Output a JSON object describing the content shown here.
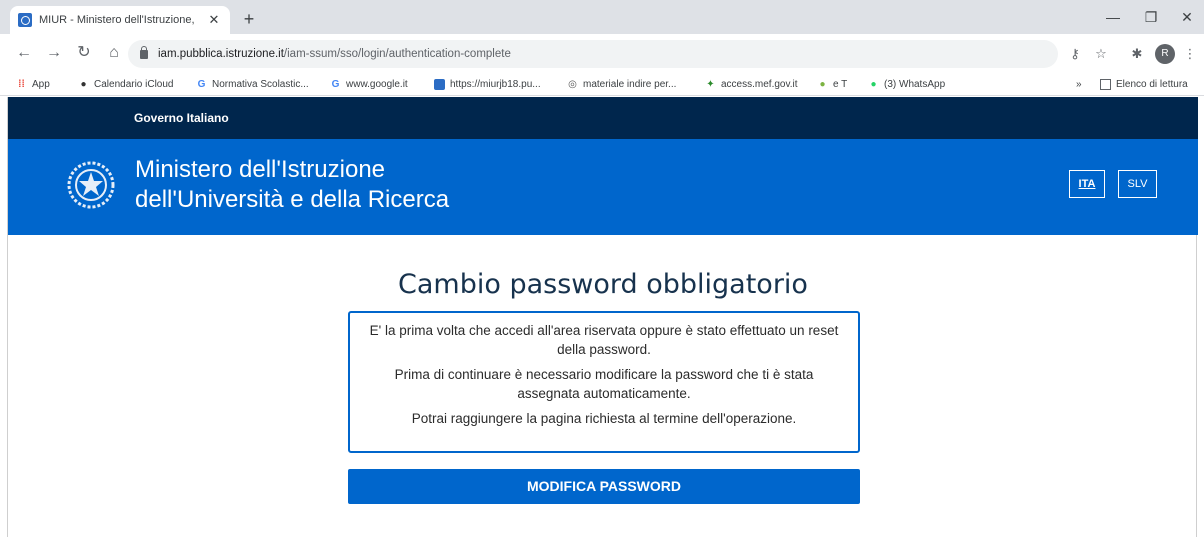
{
  "browser": {
    "tab_title": "MIUR - Ministero dell'Istruzione,",
    "tab_close": "✕",
    "new_tab": "+",
    "url_host": "iam.pubblica.istruzione.it",
    "url_path": "/iam-ssum/sso/login/authentication-complete",
    "profile_initial": "R",
    "bookmarks": [
      {
        "label": "App",
        "icon": "apps-grid-icon"
      },
      {
        "label": "Calendario iCloud",
        "icon": "apple-icon"
      },
      {
        "label": "Normativa Scolastic...",
        "icon": "google-icon"
      },
      {
        "label": "www.google.it",
        "icon": "google-icon"
      },
      {
        "label": "https://miurjb18.pu...",
        "icon": "miur-icon"
      },
      {
        "label": "materiale indire per...",
        "icon": "globe-icon"
      },
      {
        "label": "access.mef.gov.it",
        "icon": "mef-icon"
      },
      {
        "label": "e T",
        "icon": "globe-green-icon"
      },
      {
        "label": "(3) WhatsApp",
        "icon": "whatsapp-icon"
      }
    ],
    "bookmarks_overflow": "»",
    "reading_list": "Elenco di lettura"
  },
  "page": {
    "gov_label": "Governo Italiano",
    "ministry_line1": "Ministero dell'Istruzione",
    "ministry_line2": "dell'Università e della Ricerca",
    "lang_ita": "ITA",
    "lang_slv": "SLV",
    "heading": "Cambio password obbligatorio",
    "info_p1": "E' la prima volta che accedi all'area riservata oppure è stato effettuato un reset della password.",
    "info_p2": "Prima di continuare è necessario modificare la password che ti è stata assegnata automaticamente.",
    "info_p3": "Potrai raggiungere la pagina richiesta al termine dell'operazione.",
    "button_label": "MODIFICA PASSWORD"
  },
  "colors": {
    "gov_bar": "#00264d",
    "header_blue": "#0066cc",
    "heading_text": "#17324d"
  }
}
